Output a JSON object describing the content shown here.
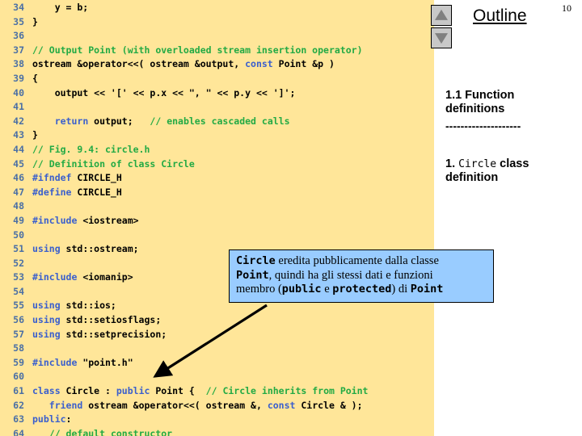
{
  "page": {
    "number": "10",
    "background": "#ffffff",
    "code_background": "#ffe699",
    "callout_background": "#99ccff",
    "comment_color": "#22aa44",
    "keyword_color": "#3a5fcd",
    "linenumber_color": "#4a6fa5"
  },
  "scroll": {
    "up_icon": "triangle-up-icon",
    "down_icon": "triangle-down-icon"
  },
  "outline": {
    "title": "Outline",
    "entry1": "1.1 Function definitions",
    "rule": "--------------------",
    "entry2_num": "1.",
    "entry2_mono": "Circle",
    "entry2_rest": " class definition"
  },
  "callout": {
    "line1_mono": "Circle",
    "line1_rest": " eredita pubblicamente dalla classe",
    "line2_mono": "Point",
    "line2_rest": ", quindi ha gli stessi dati e funzioni",
    "line3_pre": "membro (",
    "line3_mono1": "public",
    "line3_mid": " e ",
    "line3_mono2": "protected",
    "line3_post": ") di ",
    "line3_mono3": "Point"
  },
  "code": {
    "lines": [
      {
        "n": "34",
        "segs": [
          {
            "t": "    y = b;",
            "c": "tok-id"
          }
        ]
      },
      {
        "n": "35",
        "segs": [
          {
            "t": "}",
            "c": "tok-id"
          }
        ]
      },
      {
        "n": "36",
        "segs": [
          {
            "t": "",
            "c": "tok-id"
          }
        ]
      },
      {
        "n": "37",
        "segs": [
          {
            "t": "// Output Point (with overloaded stream insertion operator)",
            "c": "tok-cmt"
          }
        ]
      },
      {
        "n": "38",
        "segs": [
          {
            "t": "ostream &operator<<( ostream &output, ",
            "c": "tok-id"
          },
          {
            "t": "const",
            "c": "tok-kw"
          },
          {
            "t": " Point &p )",
            "c": "tok-id"
          }
        ]
      },
      {
        "n": "39",
        "segs": [
          {
            "t": "{",
            "c": "tok-id"
          }
        ]
      },
      {
        "n": "40",
        "segs": [
          {
            "t": "    output << '[' << p.x << \", \" << p.y << ']';",
            "c": "tok-id"
          }
        ]
      },
      {
        "n": "41",
        "segs": [
          {
            "t": "",
            "c": "tok-id"
          }
        ]
      },
      {
        "n": "42",
        "segs": [
          {
            "t": "    ",
            "c": "tok-id"
          },
          {
            "t": "return",
            "c": "tok-kw"
          },
          {
            "t": " output;   ",
            "c": "tok-id"
          },
          {
            "t": "// enables cascaded calls",
            "c": "tok-cmt"
          }
        ]
      },
      {
        "n": "43",
        "segs": [
          {
            "t": "}",
            "c": "tok-id"
          }
        ]
      },
      {
        "n": "44",
        "segs": [
          {
            "t": "// Fig. 9.4: circle.h",
            "c": "tok-cmt"
          }
        ]
      },
      {
        "n": "45",
        "segs": [
          {
            "t": "// Definition of class Circle",
            "c": "tok-cmt"
          }
        ]
      },
      {
        "n": "46",
        "segs": [
          {
            "t": "#ifndef",
            "c": "tok-pre"
          },
          {
            "t": " CIRCLE_H",
            "c": "tok-id"
          }
        ]
      },
      {
        "n": "47",
        "segs": [
          {
            "t": "#define",
            "c": "tok-pre"
          },
          {
            "t": " CIRCLE_H",
            "c": "tok-id"
          }
        ]
      },
      {
        "n": "48",
        "segs": [
          {
            "t": "",
            "c": "tok-id"
          }
        ]
      },
      {
        "n": "49",
        "segs": [
          {
            "t": "#include",
            "c": "tok-pre"
          },
          {
            "t": " <iostream>",
            "c": "tok-id"
          }
        ]
      },
      {
        "n": "50",
        "segs": [
          {
            "t": "",
            "c": "tok-id"
          }
        ]
      },
      {
        "n": "51",
        "segs": [
          {
            "t": "using",
            "c": "tok-kw"
          },
          {
            "t": " std::ostream;",
            "c": "tok-id"
          }
        ]
      },
      {
        "n": "52",
        "segs": [
          {
            "t": "",
            "c": "tok-id"
          }
        ]
      },
      {
        "n": "53",
        "segs": [
          {
            "t": "#include",
            "c": "tok-pre"
          },
          {
            "t": " <iomanip>",
            "c": "tok-id"
          }
        ]
      },
      {
        "n": "54",
        "segs": [
          {
            "t": "",
            "c": "tok-id"
          }
        ]
      },
      {
        "n": "55",
        "segs": [
          {
            "t": "using",
            "c": "tok-kw"
          },
          {
            "t": " std::ios;",
            "c": "tok-id"
          }
        ]
      },
      {
        "n": "56",
        "segs": [
          {
            "t": "using",
            "c": "tok-kw"
          },
          {
            "t": " std::setiosflags;",
            "c": "tok-id"
          }
        ]
      },
      {
        "n": "57",
        "segs": [
          {
            "t": "using",
            "c": "tok-kw"
          },
          {
            "t": " std::setprecision;",
            "c": "tok-id"
          }
        ]
      },
      {
        "n": "58",
        "segs": [
          {
            "t": "",
            "c": "tok-id"
          }
        ]
      },
      {
        "n": "59",
        "segs": [
          {
            "t": "#include",
            "c": "tok-pre"
          },
          {
            "t": " \"point.h\"",
            "c": "tok-id"
          }
        ]
      },
      {
        "n": "60",
        "segs": [
          {
            "t": "",
            "c": "tok-id"
          }
        ]
      },
      {
        "n": "61",
        "segs": [
          {
            "t": "class",
            "c": "tok-kw"
          },
          {
            "t": " Circle : ",
            "c": "tok-id"
          },
          {
            "t": "public",
            "c": "tok-kw"
          },
          {
            "t": " Point {  ",
            "c": "tok-id"
          },
          {
            "t": "// Circle inherits from Point",
            "c": "tok-cmt"
          }
        ]
      },
      {
        "n": "62",
        "segs": [
          {
            "t": "   ",
            "c": "tok-id"
          },
          {
            "t": "friend",
            "c": "tok-kw"
          },
          {
            "t": " ostream &operator<<( ostream &, ",
            "c": "tok-id"
          },
          {
            "t": "const",
            "c": "tok-kw"
          },
          {
            "t": " Circle & );",
            "c": "tok-id"
          }
        ]
      },
      {
        "n": "63",
        "segs": [
          {
            "t": "public",
            "c": "tok-kw"
          },
          {
            "t": ":",
            "c": "tok-id"
          }
        ]
      },
      {
        "n": "64",
        "segs": [
          {
            "t": "   ",
            "c": "tok-id"
          },
          {
            "t": "// default constructor",
            "c": "tok-cmt"
          }
        ]
      }
    ]
  }
}
